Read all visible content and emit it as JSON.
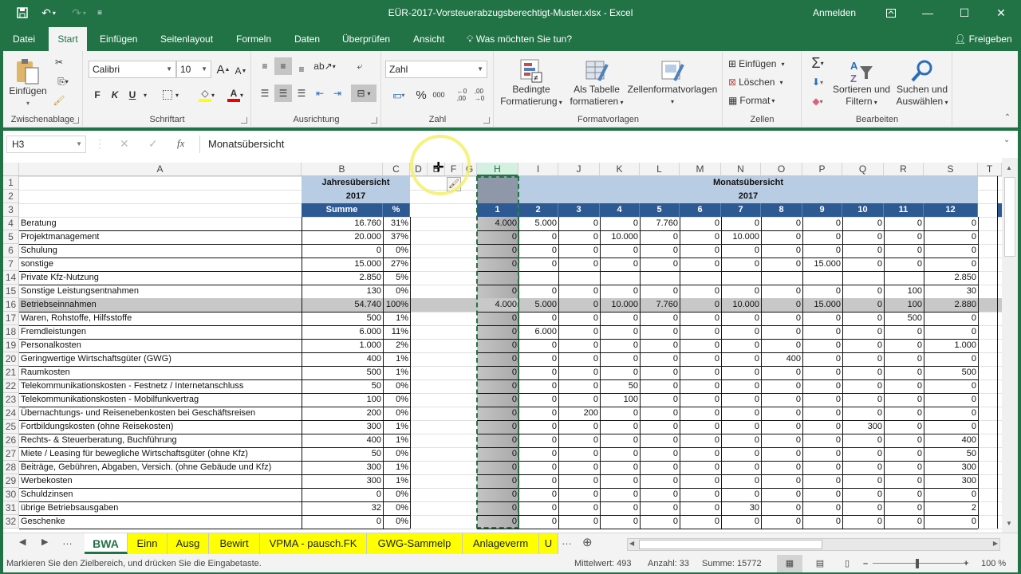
{
  "titlebar": {
    "title": "EÜR-2017-Vorsteuerabzugsberechtigt-Muster.xlsx  -  Excel",
    "login": "Anmelden"
  },
  "menu": {
    "tabs": [
      "Datei",
      "Start",
      "Einfügen",
      "Seitenlayout",
      "Formeln",
      "Daten",
      "Überprüfen",
      "Ansicht"
    ],
    "active": "Start",
    "tellme": "Was möchten Sie tun?",
    "share": "Freigeben"
  },
  "ribbon": {
    "clipboard": {
      "paste": "Einfügen",
      "label": "Zwischenablage"
    },
    "font": {
      "name": "Calibri",
      "size": "10",
      "bold": "F",
      "italic": "K",
      "underline": "U",
      "label": "Schriftart"
    },
    "alignment": {
      "label": "Ausrichtung"
    },
    "number": {
      "format": "Zahl",
      "percent": "%",
      "thousands": "000",
      "label": "Zahl"
    },
    "styles": {
      "conditional": [
        "Bedingte",
        "Formatierung"
      ],
      "as_table": [
        "Als Tabelle",
        "formatieren"
      ],
      "cell_styles": "Zellenformatvorlagen",
      "label": "Formatvorlagen"
    },
    "cells": {
      "insert": "Einfügen",
      "delete": "Löschen",
      "format": "Format",
      "label": "Zellen"
    },
    "editing": {
      "sort": [
        "Sortieren und",
        "Filtern"
      ],
      "find": [
        "Suchen und",
        "Auswählen"
      ],
      "label": "Bearbeiten"
    }
  },
  "formula_bar": {
    "name_box": "H3",
    "content": "Monatsübersicht",
    "fx": "fx"
  },
  "columns": [
    "A",
    "B",
    "C",
    "D",
    "E",
    "F",
    "G",
    "H",
    "I",
    "J",
    "K",
    "L",
    "M",
    "N",
    "O",
    "P",
    "Q",
    "R",
    "S",
    "T"
  ],
  "header": {
    "year_title": "Jahresübersicht",
    "year": "2017",
    "sum": "Summe",
    "pct": "%",
    "month_title": "Monatsübersicht",
    "months": [
      "1",
      "2",
      "3",
      "4",
      "5",
      "6",
      "7",
      "8",
      "9",
      "10",
      "11",
      "12"
    ]
  },
  "rows": [
    {
      "num": "4",
      "label": "Beratung",
      "sum": "16.760",
      "pct": "31%",
      "m": [
        "4.000",
        "5.000",
        "0",
        "0",
        "7.760",
        "0",
        "0",
        "0",
        "0",
        "0",
        "0",
        "0"
      ]
    },
    {
      "num": "5",
      "label": "Projektmanagement",
      "sum": "20.000",
      "pct": "37%",
      "m": [
        "0",
        "0",
        "0",
        "10.000",
        "0",
        "0",
        "10.000",
        "0",
        "0",
        "0",
        "0",
        "0"
      ]
    },
    {
      "num": "6",
      "label": "Schulung",
      "sum": "0",
      "pct": "0%",
      "m": [
        "0",
        "0",
        "0",
        "0",
        "0",
        "0",
        "0",
        "0",
        "0",
        "0",
        "0",
        "0"
      ]
    },
    {
      "num": "7",
      "label": "sonstige",
      "sum": "15.000",
      "pct": "27%",
      "m": [
        "0",
        "0",
        "0",
        "0",
        "0",
        "0",
        "0",
        "0",
        "15.000",
        "0",
        "0",
        "0"
      ]
    },
    {
      "num": "14",
      "label": "Private Kfz-Nutzung",
      "sum": "2.850",
      "pct": "5%",
      "m": [
        "",
        "",
        "",
        "",
        "",
        "",
        "",
        "",
        "",
        "",
        "",
        "2.850"
      ]
    },
    {
      "num": "15",
      "label": "Sonstige Leistungsentnahmen",
      "sum": "130",
      "pct": "0%",
      "m": [
        "0",
        "0",
        "0",
        "0",
        "0",
        "0",
        "0",
        "0",
        "0",
        "0",
        "100",
        "30"
      ]
    },
    {
      "num": "16",
      "label": "Betriebseinnahmen",
      "sum": "54.740",
      "pct": "100%",
      "total": true,
      "m": [
        "4.000",
        "5.000",
        "0",
        "10.000",
        "7.760",
        "0",
        "10.000",
        "0",
        "15.000",
        "0",
        "100",
        "2.880"
      ]
    },
    {
      "num": "17",
      "label": "Waren, Rohstoffe, Hilfsstoffe",
      "sum": "500",
      "pct": "1%",
      "m": [
        "0",
        "0",
        "0",
        "0",
        "0",
        "0",
        "0",
        "0",
        "0",
        "0",
        "500",
        "0"
      ]
    },
    {
      "num": "18",
      "label": "Fremdleistungen",
      "sum": "6.000",
      "pct": "11%",
      "m": [
        "0",
        "6.000",
        "0",
        "0",
        "0",
        "0",
        "0",
        "0",
        "0",
        "0",
        "0",
        "0"
      ]
    },
    {
      "num": "19",
      "label": "Personalkosten",
      "sum": "1.000",
      "pct": "2%",
      "m": [
        "0",
        "0",
        "0",
        "0",
        "0",
        "0",
        "0",
        "0",
        "0",
        "0",
        "0",
        "1.000"
      ]
    },
    {
      "num": "20",
      "label": "Geringwertige Wirtschaftsgüter (GWG)",
      "sum": "400",
      "pct": "1%",
      "m": [
        "0",
        "0",
        "0",
        "0",
        "0",
        "0",
        "0",
        "400",
        "0",
        "0",
        "0",
        "0"
      ]
    },
    {
      "num": "21",
      "label": "Raumkosten",
      "sum": "500",
      "pct": "1%",
      "m": [
        "0",
        "0",
        "0",
        "0",
        "0",
        "0",
        "0",
        "0",
        "0",
        "0",
        "0",
        "500"
      ]
    },
    {
      "num": "22",
      "label": "Telekommunikationskosten - Festnetz / Internetanschluss",
      "sum": "50",
      "pct": "0%",
      "m": [
        "0",
        "0",
        "0",
        "50",
        "0",
        "0",
        "0",
        "0",
        "0",
        "0",
        "0",
        "0"
      ]
    },
    {
      "num": "23",
      "label": "Telekommunikationskosten - Mobilfunkvertrag",
      "sum": "100",
      "pct": "0%",
      "m": [
        "0",
        "0",
        "0",
        "100",
        "0",
        "0",
        "0",
        "0",
        "0",
        "0",
        "0",
        "0"
      ]
    },
    {
      "num": "24",
      "label": "Übernachtungs- und Reisenebenkosten bei Geschäftsreisen",
      "sum": "200",
      "pct": "0%",
      "m": [
        "0",
        "0",
        "200",
        "0",
        "0",
        "0",
        "0",
        "0",
        "0",
        "0",
        "0",
        "0"
      ]
    },
    {
      "num": "25",
      "label": "Fortbildungskosten (ohne Reisekosten)",
      "sum": "300",
      "pct": "1%",
      "m": [
        "0",
        "0",
        "0",
        "0",
        "0",
        "0",
        "0",
        "0",
        "0",
        "300",
        "0",
        "0"
      ]
    },
    {
      "num": "26",
      "label": "Rechts- & Steuerberatung, Buchführung",
      "sum": "400",
      "pct": "1%",
      "m": [
        "0",
        "0",
        "0",
        "0",
        "0",
        "0",
        "0",
        "0",
        "0",
        "0",
        "0",
        "400"
      ]
    },
    {
      "num": "27",
      "label": "Miete / Leasing für bewegliche Wirtschaftsgüter (ohne Kfz)",
      "sum": "50",
      "pct": "0%",
      "m": [
        "0",
        "0",
        "0",
        "0",
        "0",
        "0",
        "0",
        "0",
        "0",
        "0",
        "0",
        "50"
      ]
    },
    {
      "num": "28",
      "label": "Beiträge, Gebühren, Abgaben, Versich. (ohne Gebäude und Kfz)",
      "sum": "300",
      "pct": "1%",
      "m": [
        "0",
        "0",
        "0",
        "0",
        "0",
        "0",
        "0",
        "0",
        "0",
        "0",
        "0",
        "300"
      ]
    },
    {
      "num": "29",
      "label": "Werbekosten",
      "sum": "300",
      "pct": "1%",
      "m": [
        "0",
        "0",
        "0",
        "0",
        "0",
        "0",
        "0",
        "0",
        "0",
        "0",
        "0",
        "300"
      ]
    },
    {
      "num": "30",
      "label": "Schuldzinsen",
      "sum": "0",
      "pct": "0%",
      "m": [
        "0",
        "0",
        "0",
        "0",
        "0",
        "0",
        "0",
        "0",
        "0",
        "0",
        "0",
        "0"
      ]
    },
    {
      "num": "31",
      "label": "übrige Betriebsausgaben",
      "sum": "32",
      "pct": "0%",
      "m": [
        "0",
        "0",
        "0",
        "0",
        "0",
        "0",
        "30",
        "0",
        "0",
        "0",
        "0",
        "2"
      ]
    },
    {
      "num": "32",
      "label": "Geschenke",
      "sum": "0",
      "pct": "0%",
      "m": [
        "0",
        "0",
        "0",
        "0",
        "0",
        "0",
        "0",
        "0",
        "0",
        "0",
        "0",
        "0"
      ]
    }
  ],
  "sheet_tabs": [
    "BWA",
    "Einn",
    "Ausg",
    "Bewirt",
    "VPMA - pausch.FK",
    "GWG-Sammelp",
    "Anlageverm",
    "U"
  ],
  "active_sheet": "BWA",
  "tab_colors": {
    "active": "#ffffff",
    "other": "#ffff00"
  },
  "status": {
    "message": "Markieren Sie den Zielbereich, und drücken Sie die Eingabetaste.",
    "average": "Mittelwert: 493",
    "count": "Anzahl: 33",
    "sum": "Summe: 15772",
    "zoom": "100 %"
  },
  "colors": {
    "brand": "#217346",
    "header_light": "#b8cce4",
    "header_dark": "#2e5a94",
    "total_row": "#c8c8c8"
  }
}
